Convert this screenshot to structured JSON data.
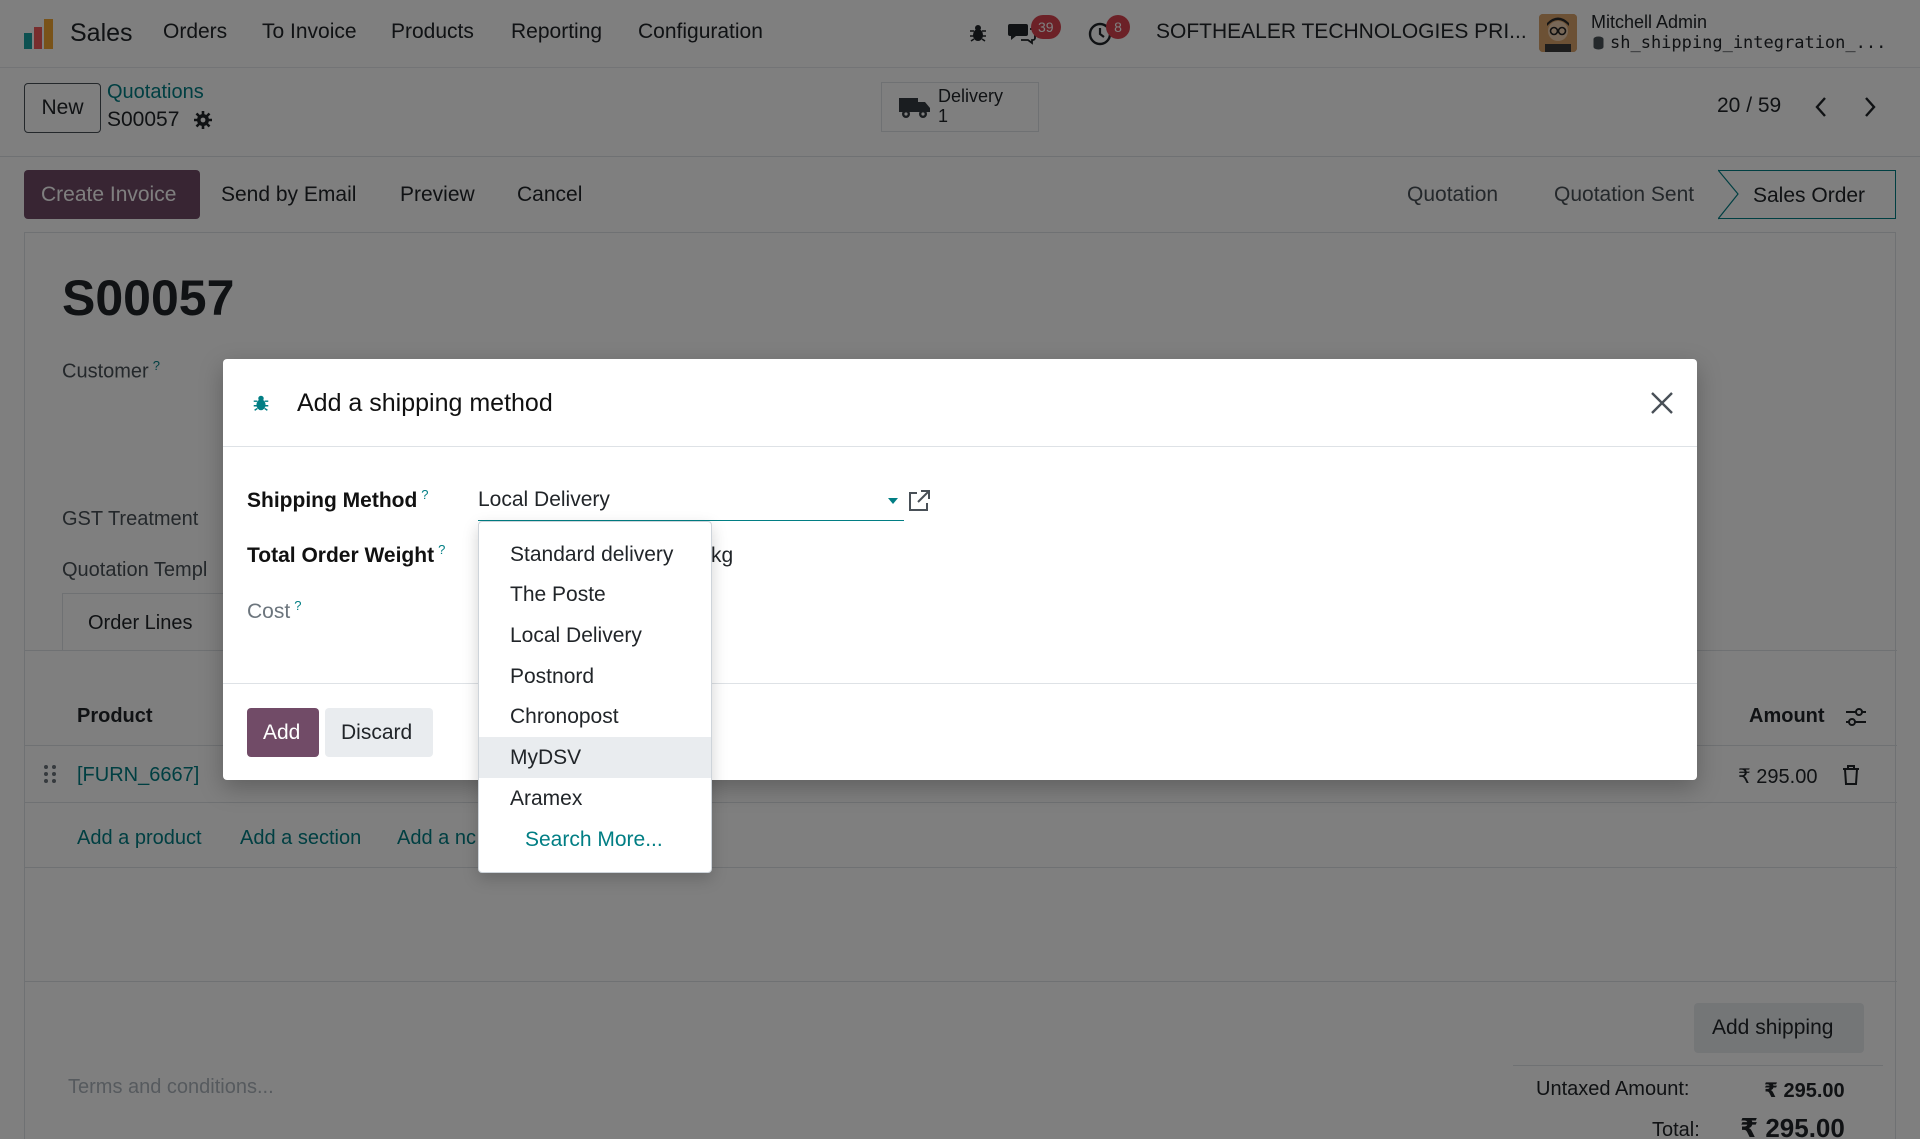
{
  "navbar": {
    "app_name": "Sales",
    "menu": [
      "Orders",
      "To Invoice",
      "Products",
      "Reporting",
      "Configuration"
    ],
    "messages_count": "39",
    "activities_count": "8",
    "company": "SOFTHEALER TECHNOLOGIES PRI...",
    "user_name": "Mitchell Admin",
    "database": "sh_shipping_integration_..."
  },
  "control_panel": {
    "new_label": "New",
    "breadcrumb_parent": "Quotations",
    "record_name": "S00057",
    "smart_button_label": "Delivery",
    "smart_button_count": "1",
    "pager": "20 / 59"
  },
  "actions": {
    "create_invoice": "Create Invoice",
    "send_email": "Send by Email",
    "preview": "Preview",
    "cancel": "Cancel"
  },
  "statusbar": [
    "Quotation",
    "Quotation Sent",
    "Sales Order"
  ],
  "sheet": {
    "title": "S00057",
    "customer_label": "Customer",
    "gst_label": "GST Treatment",
    "template_label": "Quotation Templ",
    "tab_order_lines": "Order Lines",
    "col_product": "Product",
    "col_amount": "Amount",
    "row_product": "[FURN_6667]",
    "row_amount": "₹ 295.00",
    "add_product": "Add a product",
    "add_section": "Add a section",
    "add_note": "Add a nc",
    "terms_placeholder": "Terms and conditions...",
    "add_shipping": "Add shipping",
    "untaxed_label": "Untaxed Amount:",
    "untaxed_value": "₹ 295.00",
    "total_label": "Total:",
    "total_value": "₹ 295.00"
  },
  "modal": {
    "title": "Add a shipping method",
    "shipping_method_label": "Shipping Method",
    "shipping_method_value": "Local Delivery",
    "weight_label": "Total Order Weight",
    "weight_unit": "kg",
    "cost_label": "Cost",
    "help_mark": "?",
    "add_label": "Add",
    "discard_label": "Discard"
  },
  "dropdown": {
    "options": [
      "Standard delivery",
      "The Poste",
      "Local Delivery",
      "Postnord",
      "Chronopost",
      "MyDSV",
      "Aramex"
    ],
    "highlighted": "MyDSV",
    "search_more": "Search More..."
  },
  "colors": {
    "primary": "#714b67",
    "link": "#017e84",
    "badge": "#d9434e"
  }
}
